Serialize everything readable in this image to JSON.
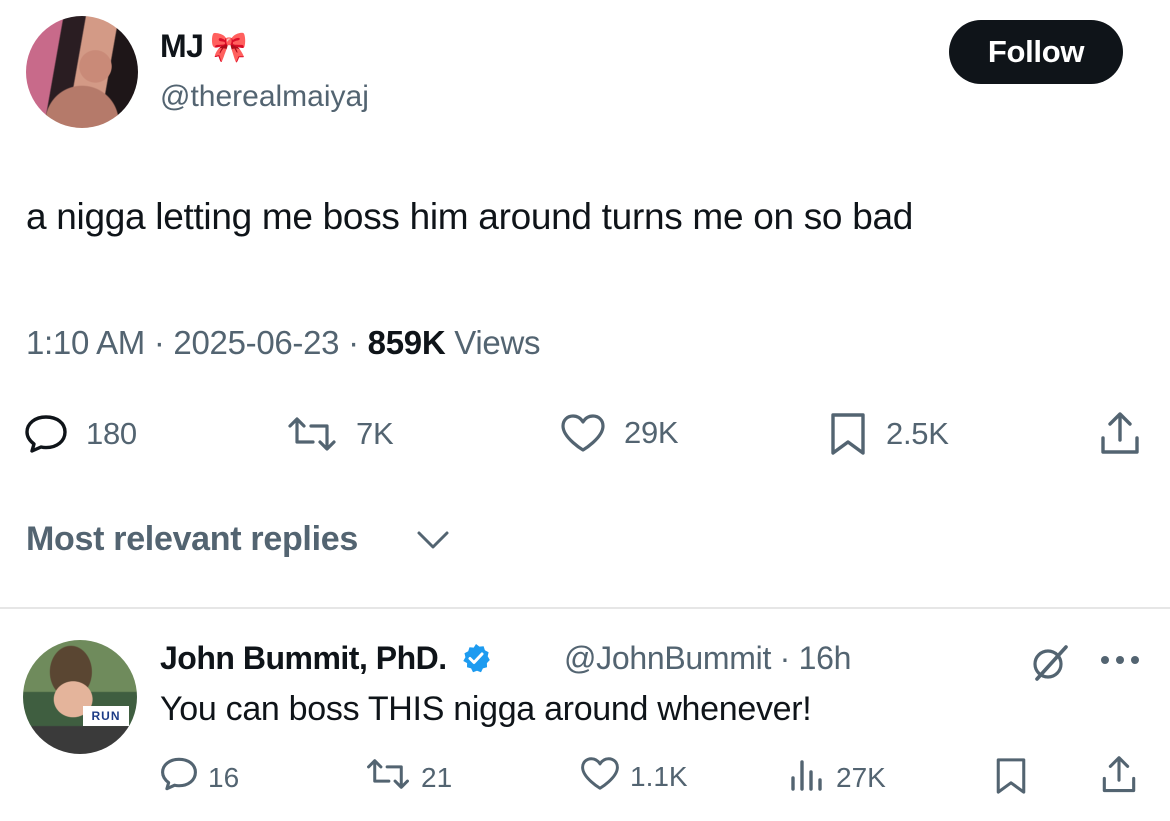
{
  "tweet": {
    "author_name": "MJ",
    "author_emoji": "🎀",
    "author_handle": "@therealmaiyaj",
    "follow_label": "Follow",
    "text": "a nigga letting me boss him around turns me on so bad",
    "time": "1:10 AM",
    "date": "2025-06-23",
    "views_count": "859K",
    "views_label": "Views",
    "stats": {
      "replies": "180",
      "reposts": "7K",
      "likes": "29K",
      "bookmarks": "2.5K"
    }
  },
  "replies_section": {
    "sort_label": "Most relevant replies"
  },
  "reply": {
    "author_name": "John Bummit, PhD.",
    "author_handle": "@JohnBummit",
    "age": "16h",
    "text": "You can boss THIS nigga around whenever!",
    "avatar_sign_text": "RUN",
    "stats": {
      "replies": "16",
      "reposts": "21",
      "likes": "1.1K",
      "views": "27K"
    }
  },
  "colors": {
    "text_primary": "#0f1419",
    "text_secondary": "#536471",
    "verified_badge": "#1d9bf0",
    "follow_button_bg": "#0f1419"
  },
  "icons": [
    "reply-icon",
    "repost-icon",
    "like-icon",
    "bookmark-icon",
    "share-icon",
    "chevron-down-icon",
    "verified-badge-icon",
    "grok-icon",
    "more-icon",
    "views-icon"
  ]
}
